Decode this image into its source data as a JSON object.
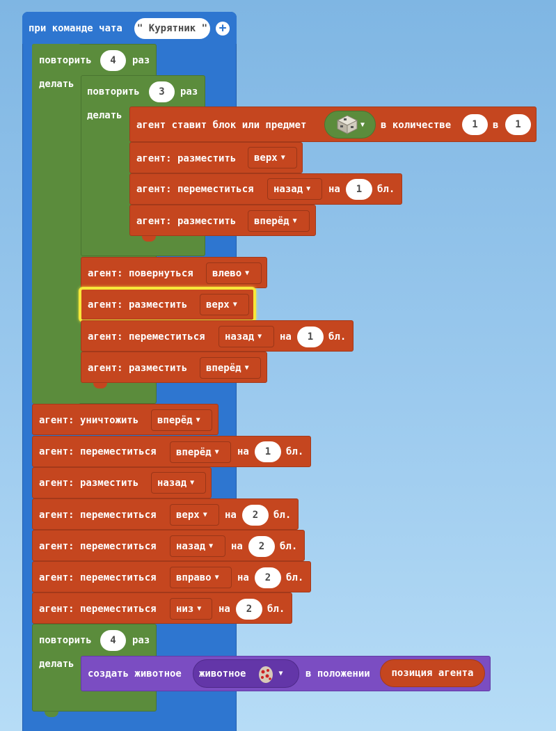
{
  "colors": {
    "events": "#2e76d0",
    "loops": "#5b8c3c",
    "agent": "#c5461f",
    "mobs": "#7b4dc2",
    "highlight": "#f7e83a"
  },
  "event": {
    "label": "при команде чата",
    "command": "\" Курятник \"",
    "add_icon": "plus-circle-icon"
  },
  "loop_outer": {
    "repeat": "повторить",
    "count": "4",
    "times": "раз",
    "do": "делать"
  },
  "loop_inner": {
    "repeat": "повторить",
    "count": "3",
    "times": "раз",
    "do": "делать"
  },
  "place_block": {
    "label": "агент ставит блок или предмет",
    "item_icon": "block-item-icon",
    "qty_label": "в количестве",
    "qty": "1",
    "in_label": "в",
    "slot": "1"
  },
  "inner_blocks": [
    {
      "label": "агент: разместить",
      "dir": "верх"
    },
    {
      "label": "агент: переместиться",
      "dir": "назад",
      "on": "на",
      "amount": "1",
      "unit": "бл."
    },
    {
      "label": "агент: разместить",
      "dir": "вперёд"
    }
  ],
  "mid_blocks": [
    {
      "label": "агент: повернуться",
      "dir": "влево"
    },
    {
      "label": "агент: разместить",
      "dir": "верх"
    },
    {
      "label": "агент: переместиться",
      "dir": "назад",
      "on": "на",
      "amount": "1",
      "unit": "бл."
    },
    {
      "label": "агент: разместить",
      "dir": "вперёд"
    }
  ],
  "after_blocks": [
    {
      "label": "агент: уничтожить",
      "dir": "вперёд"
    },
    {
      "label": "агент: переместиться",
      "dir": "вперёд",
      "on": "на",
      "amount": "1",
      "unit": "бл."
    },
    {
      "label": "агент: разместить",
      "dir": "назад"
    },
    {
      "label": "агент: переместиться",
      "dir": "верх",
      "on": "на",
      "amount": "2",
      "unit": "бл."
    },
    {
      "label": "агент: переместиться",
      "dir": "назад",
      "on": "на",
      "amount": "2",
      "unit": "бл."
    },
    {
      "label": "агент: переместиться",
      "dir": "вправо",
      "on": "на",
      "amount": "2",
      "unit": "бл."
    },
    {
      "label": "агент: переместиться",
      "dir": "низ",
      "on": "на",
      "amount": "2",
      "unit": "бл."
    }
  ],
  "loop_last": {
    "repeat": "повторить",
    "count": "4",
    "times": "раз",
    "do": "делать"
  },
  "spawn": {
    "label": "создать животное",
    "animal": "животное",
    "animal_icon": "chicken-egg-icon",
    "pos_label": "в положении",
    "position": "позиция агента"
  }
}
